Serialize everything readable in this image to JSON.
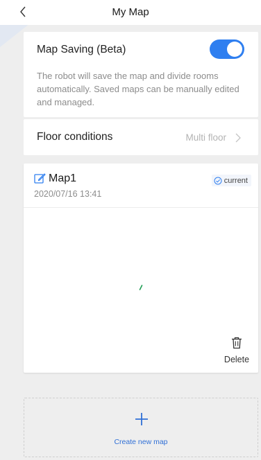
{
  "header": {
    "title": "My Map",
    "back_icon": "chevron-left-icon"
  },
  "map_saving": {
    "label": "Map Saving (Beta)",
    "enabled": true,
    "description": "The robot will save the map and divide rooms automatically. Saved maps can be manually edited and managed.",
    "toggle_color": "#2f7ff0"
  },
  "floor_conditions": {
    "label": "Floor conditions",
    "value": "Multi floor",
    "chevron_icon": "chevron-right-icon"
  },
  "maps": [
    {
      "name": "Map1",
      "date": "2020/07/16 13:41",
      "badge": "current",
      "edit_icon": "edit-icon",
      "badge_icon": "check-circle-icon",
      "delete_label": "Delete",
      "delete_icon": "trash-icon"
    }
  ],
  "create_map": {
    "label": "Create new map",
    "icon": "plus-icon"
  },
  "colors": {
    "accent": "#2f7ff0",
    "link": "#2f6fd6",
    "background": "#eeeeee"
  }
}
